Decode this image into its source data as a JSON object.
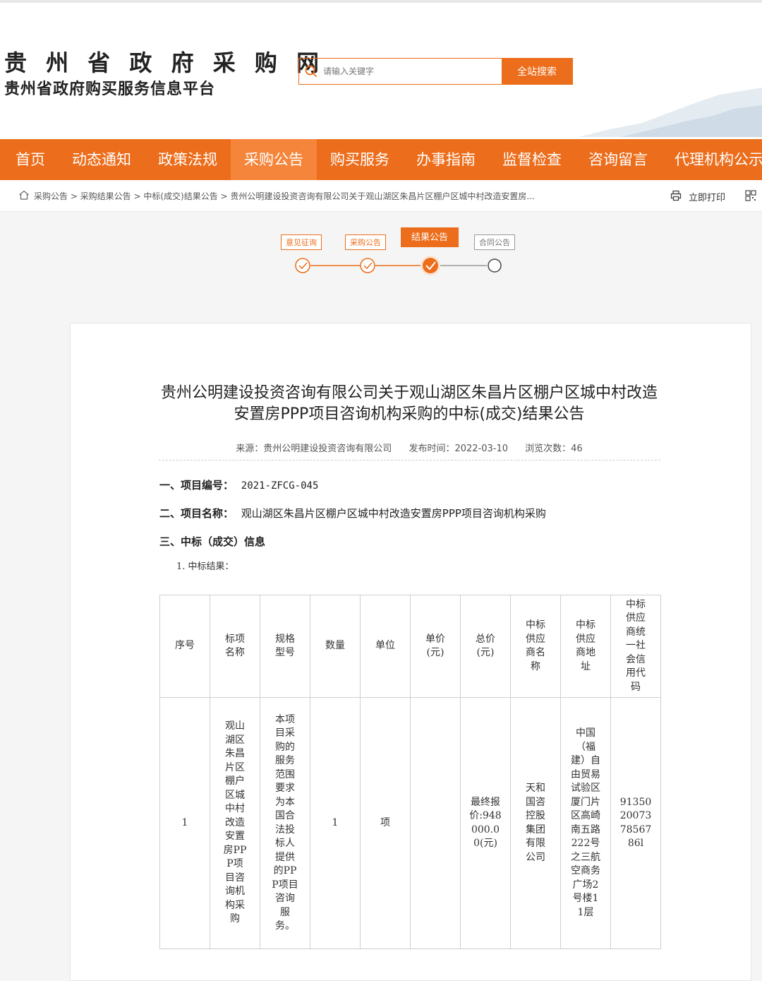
{
  "site": {
    "title": "贵 州 省 政 府 采 购 网",
    "subtitle": "贵州省政府购买服务信息平台"
  },
  "search": {
    "placeholder": "请输入关键字",
    "button": "全站搜索"
  },
  "nav": {
    "items": [
      "首页",
      "动态通知",
      "政策法规",
      "采购公告",
      "购买服务",
      "办事指南",
      "监督检查",
      "咨询留言",
      "代理机构公示"
    ],
    "active": "采购公告"
  },
  "breadcrumb": "采购公告 > 采购结果公告 > 中标(成交)结果公告 > 贵州公明建设投资咨询有限公司关于观山湖区朱昌片区棚户区城中村改造安置房...",
  "print_label": "立即打印",
  "steps": [
    "意见征询",
    "采购公告",
    "结果公告",
    "合同公告"
  ],
  "article": {
    "title": "贵州公明建设投资咨询有限公司关于观山湖区朱昌片区棚户区城中村改造安置房PPP项目咨询机构采购的中标(成交)结果公告",
    "source": "来源：贵州公明建设投资咨询有限公司",
    "date": "发布时间：2022-03-10",
    "views": "浏览次数：46",
    "project_no_label": "一、项目编号：",
    "project_no": "2021-ZFCG-045",
    "project_name_label": "二、项目名称：",
    "project_name": "观山湖区朱昌片区棚户区城中村改造安置房PPP项目咨询机构采购",
    "section3": "三、中标（成交）信息",
    "sub1": "1. 中标结果："
  },
  "table": {
    "headers": [
      "序号",
      "标项名称",
      "规格型号",
      "数量",
      "单位",
      "单价(元)",
      "总价(元)",
      "中标供应商名称",
      "中标供应商地址",
      "中标供应商统一社会信用代码"
    ],
    "row": [
      "1",
      "观山湖区朱昌片区棚户区城中村改造安置房PPP项目咨询机构采购",
      "本项目采购的服务范围要求为本国合法投标人提供的PPP项目咨询服务。",
      "1",
      "项",
      "",
      "最终报价:948000.00(元)",
      "天和国咨控股集团有限公司",
      "中国（福建）自由贸易试验区厦门片区高崎南五路222号之三航空商务广场2号楼11层",
      "91350200737856786l"
    ]
  },
  "colors": {
    "accent": "#ec6d1b"
  }
}
